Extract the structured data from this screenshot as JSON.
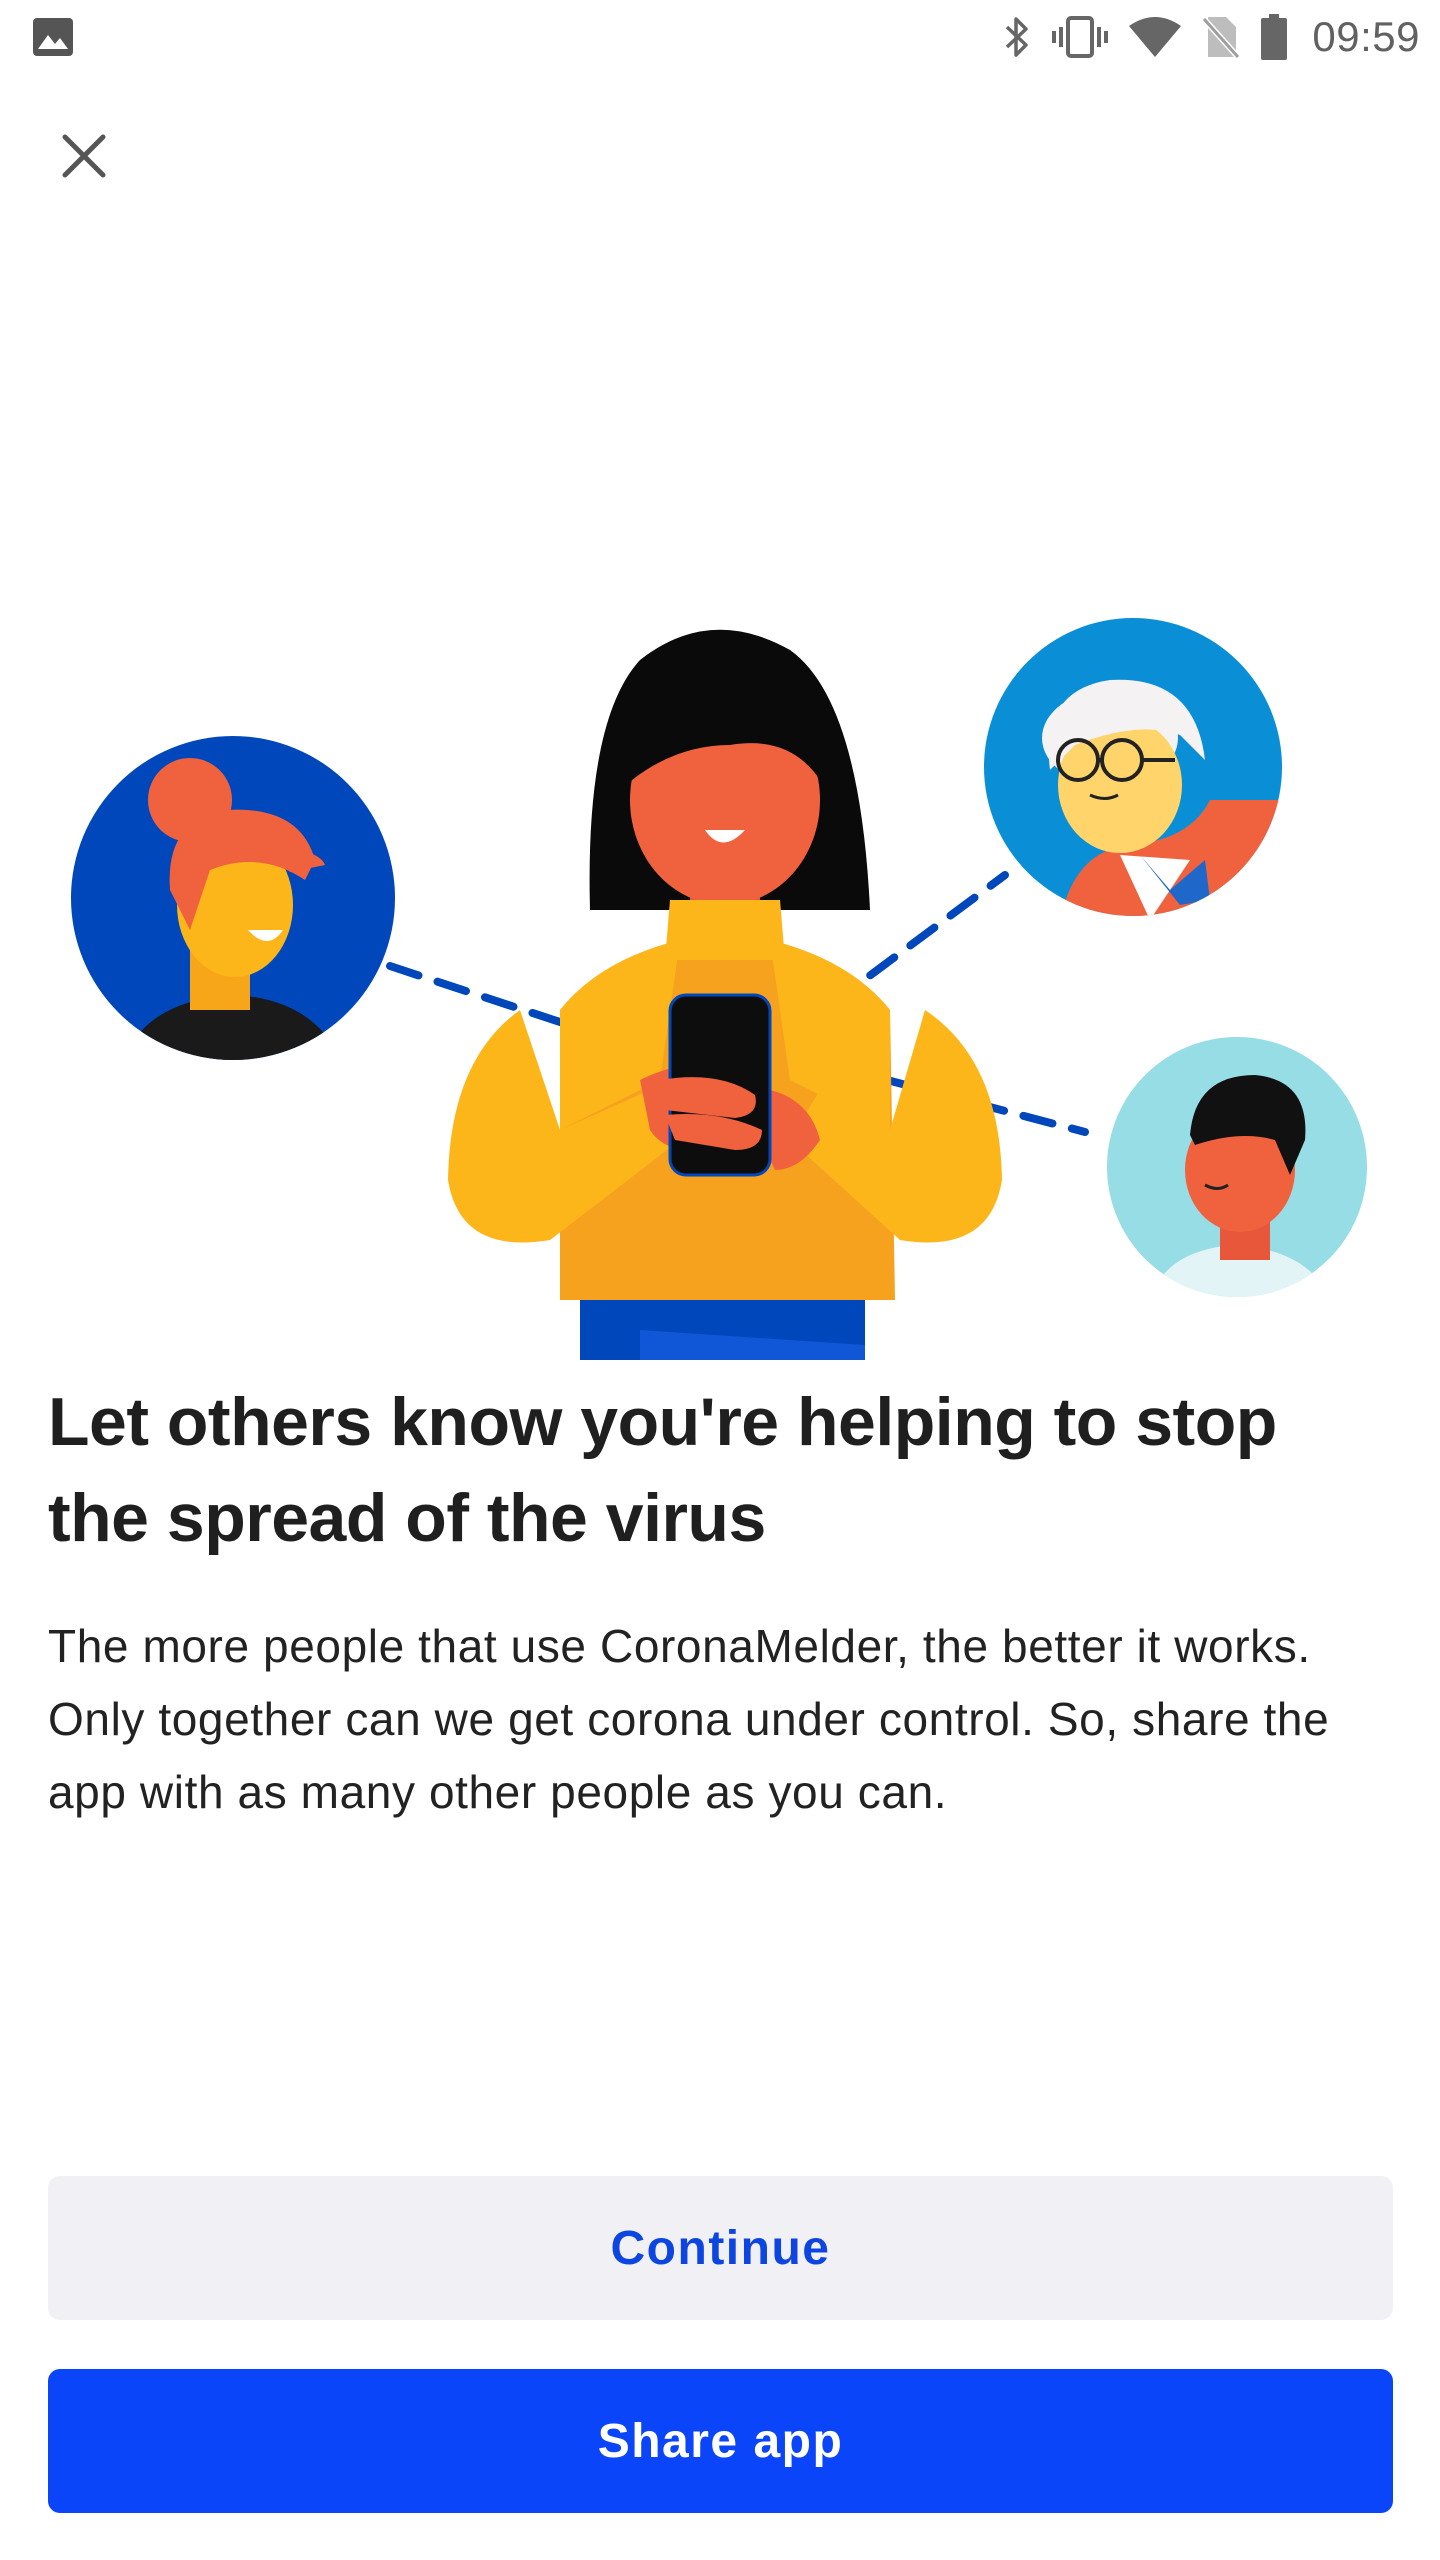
{
  "status_bar": {
    "time": "09:59",
    "icons": [
      "image-notification-icon",
      "bluetooth-icon",
      "vibrate-icon",
      "wifi-icon",
      "no-sim-icon",
      "battery-icon"
    ]
  },
  "close_button": {
    "icon": "close-icon"
  },
  "onboarding": {
    "headline": "Let others know you're helping to stop the spread of the virus",
    "body": "The more people that use CoronaMelder, the better it works. Only together can we get corona under control. So, share the app with as many other people as you can."
  },
  "actions": {
    "continue_label": "Continue",
    "share_label": "Share app"
  },
  "colors": {
    "primary_blue": "#0a45fa",
    "secondary_bg": "#f1f1f5",
    "continue_text": "#0c45e0",
    "illustration_yellow": "#fdb61a",
    "illustration_orange": "#f0623e",
    "illustration_dark_blue": "#0047bb",
    "illustration_light_blue": "#97dde5"
  }
}
